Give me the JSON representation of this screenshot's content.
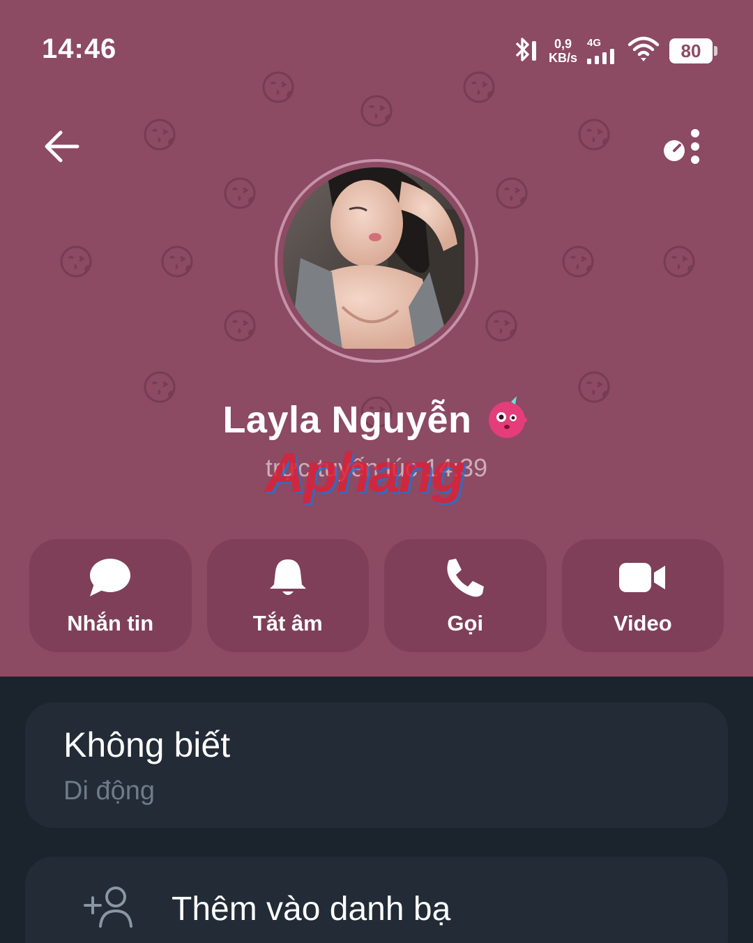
{
  "status_bar": {
    "time": "14:46",
    "net_speed_value": "0,9",
    "net_speed_unit": "KB/s",
    "network_type": "4G",
    "battery": "80"
  },
  "contact": {
    "name": "Layla Nguyễn",
    "status": "trực tuyến lúc 14:39"
  },
  "watermark": "Aphang",
  "actions": [
    {
      "label": "Nhắn tin",
      "icon": "message-icon"
    },
    {
      "label": "Tắt âm",
      "icon": "bell-icon"
    },
    {
      "label": "Gọi",
      "icon": "phone-icon"
    },
    {
      "label": "Video",
      "icon": "video-camera-icon"
    }
  ],
  "phone_info": {
    "value": "Không biết",
    "type": "Di động"
  },
  "add_contact": {
    "label": "Thêm vào danh bạ"
  },
  "colors": {
    "header_bg": "#8c4a63",
    "action_bg": "#7f3f58",
    "body_bg": "#1b232c",
    "card_bg": "#222b36"
  }
}
